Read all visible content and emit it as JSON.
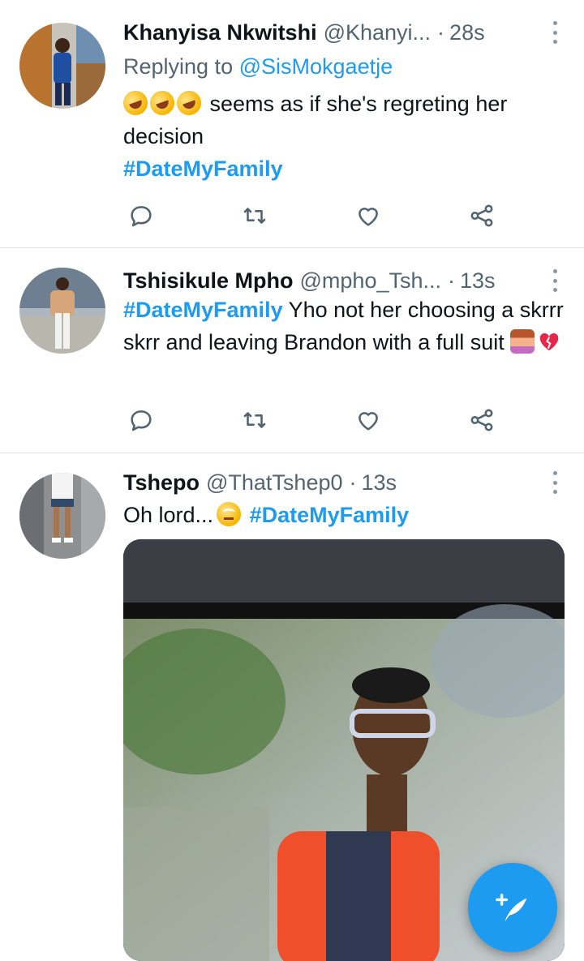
{
  "tweets": [
    {
      "name": "Khanyisa Nkwitshi",
      "handle": "@Khanyi...",
      "time": "28s",
      "reply_prefix": "Replying to",
      "reply_to": "@SisMokgaetje",
      "text": "seems as if she's regreting her decision",
      "hashtag": "#DateMyFamily"
    },
    {
      "name": "Tshisikule Mpho",
      "handle": "@mpho_Tsh...",
      "time": "13s",
      "hashtag": "#DateMyFamily",
      "text": "Yho not her choosing a skrrr skrr and leaving Brandon with a full suit"
    },
    {
      "name": "Tshepo",
      "handle": "@ThatTshep0",
      "time": "13s",
      "text": "Oh lord...",
      "hashtag": "#DateMyFamily"
    }
  ],
  "separator": "·",
  "icons": {
    "reply": "reply-icon",
    "retweet": "retweet-icon",
    "like": "like-icon",
    "share": "share-icon",
    "more": "more-icon",
    "compose": "compose-tweet-icon"
  },
  "colors": {
    "link": "#1d9bf0",
    "muted": "#536471",
    "fab": "#1d9bf0"
  }
}
